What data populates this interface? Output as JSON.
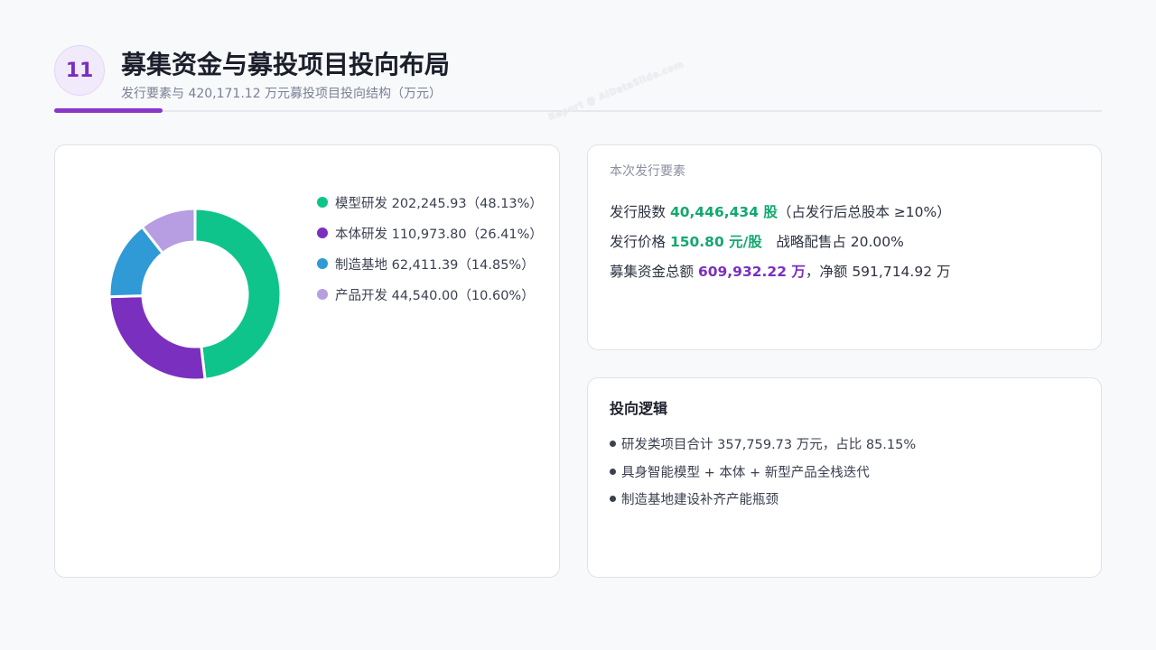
{
  "header": {
    "page_number": "11",
    "title": "募集资金与募投项目投向布局",
    "subtitle": "发行要素与 420,171.12 万元募投项目投向结构（万元）"
  },
  "watermark": "Report @ AIDataSlide.com",
  "chart_data": {
    "type": "pie",
    "style": "donut",
    "legend_position": "right",
    "categories": [
      "模型研发",
      "本体研发",
      "制造基地",
      "产品开发"
    ],
    "values": [
      202245.93,
      110973.8,
      62411.39,
      44540.0
    ],
    "percentages": [
      48.13,
      26.41,
      14.85,
      10.6
    ],
    "colors": [
      "#0fc48a",
      "#7b2fbf",
      "#2f9ad6",
      "#b79de2"
    ],
    "legend_labels": [
      "模型研发 202,245.93（48.13%）",
      "本体研发 110,973.80（26.41%）",
      "制造基地 62,411.39（14.85%）",
      "产品开发 44,540.00（10.60%）"
    ]
  },
  "issue": {
    "label": "本次发行要素",
    "shares_prefix": "发行股数 ",
    "shares_value": "40,446,434 股",
    "shares_suffix": "（占发行后总股本 ≥10%）",
    "price_prefix": "发行价格 ",
    "price_value": "150.80 元/股",
    "price_suffix": "　战略配售占 20.00%",
    "total_prefix": "募集资金总额 ",
    "total_value": "609,932.22 万",
    "total_suffix": "，净额 591,714.92 万"
  },
  "logic": {
    "title": "投向逻辑",
    "items": [
      "研发类项目合计 357,759.73 万元，占比 85.15%",
      "具身智能模型 + 本体 + 新型产品全栈迭代",
      "制造基地建设补齐产能瓶颈"
    ]
  }
}
